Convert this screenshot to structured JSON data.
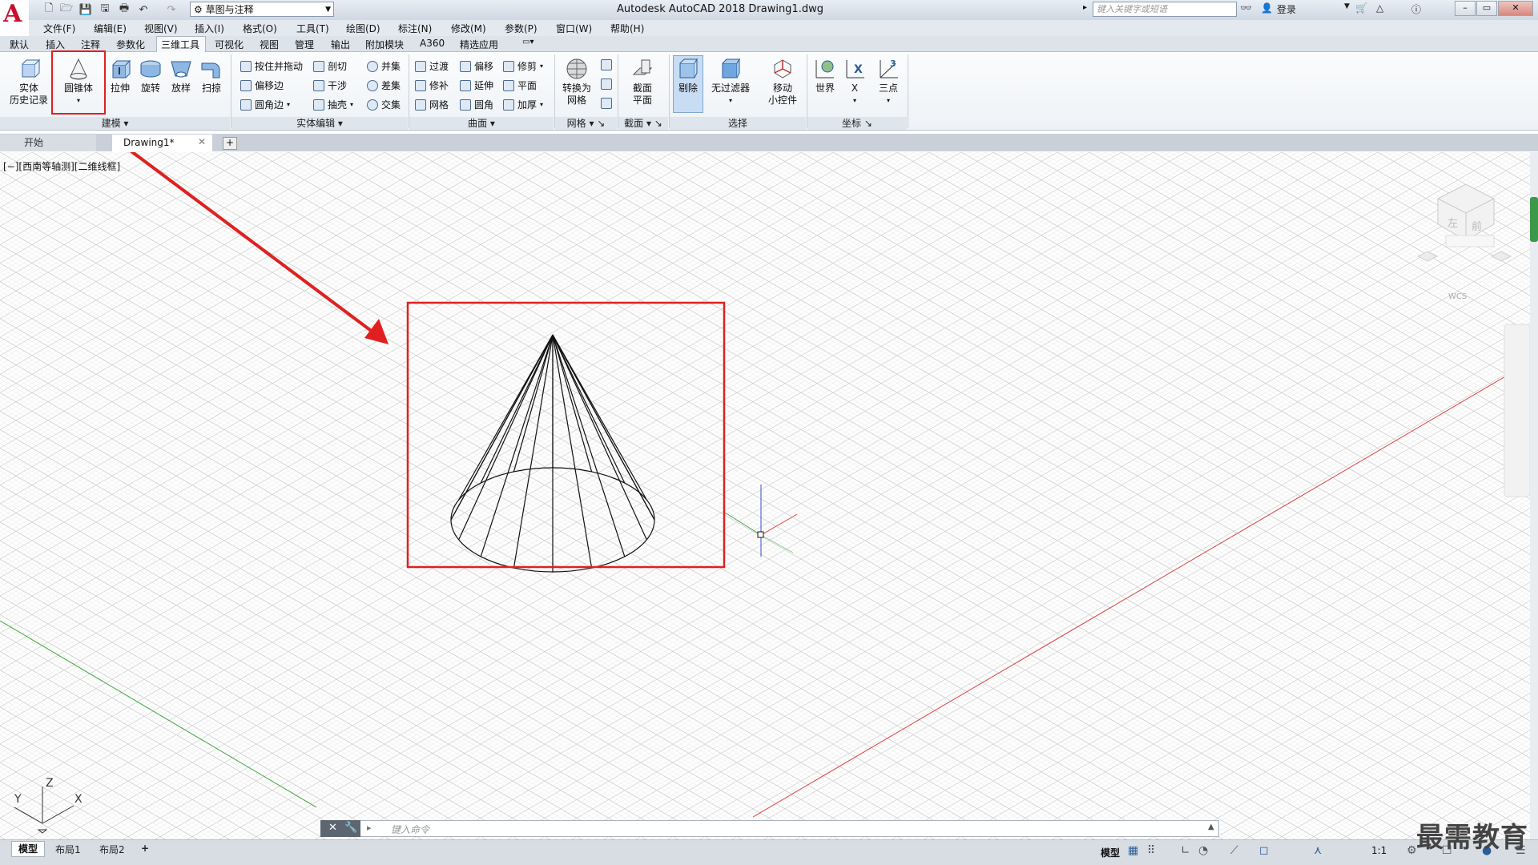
{
  "app": {
    "title": "Autodesk AutoCAD 2018    Drawing1.dwg",
    "logo": "A",
    "workspace": "草图与注释",
    "search_placeholder": "键入关键字或短语",
    "login": "登录"
  },
  "menus": [
    "文件(F)",
    "编辑(E)",
    "视图(V)",
    "插入(I)",
    "格式(O)",
    "工具(T)",
    "绘图(D)",
    "标注(N)",
    "修改(M)",
    "参数(P)",
    "窗口(W)",
    "帮助(H)"
  ],
  "ribbon_tabs": [
    "默认",
    "插入",
    "注释",
    "参数化",
    "三维工具",
    "可视化",
    "视图",
    "管理",
    "输出",
    "附加模块",
    "A360",
    "精选应用"
  ],
  "ribbon_active_tab": "三维工具",
  "ribbon": {
    "modeling": {
      "title": "建模",
      "history_label": "实体\n历史记录",
      "cone_label": "圆锥体",
      "extrude_label": "拉伸",
      "revolve_label": "旋转",
      "loft_label": "放样",
      "sweep_label": "扫掠"
    },
    "solid_edit": {
      "title": "实体编辑",
      "items": [
        "按住并拖动",
        "偏移边",
        "圆角边",
        "剖切",
        "干涉",
        "抽壳",
        "并集",
        "差集",
        "交集"
      ]
    },
    "surface": {
      "title": "曲面",
      "items": [
        "过渡",
        "修补",
        "网格",
        "偏移",
        "延伸",
        "圆角",
        "修剪",
        "平面",
        "加厚"
      ]
    },
    "mesh": {
      "title": "网格",
      "convert_label": "转换为\n网格"
    },
    "section": {
      "title": "截面",
      "plane_label": "截面\n平面"
    },
    "selection": {
      "title": "选择",
      "delete_label": "剔除",
      "nofilter_label": "无过滤器",
      "gizmo_label": "移动\n小控件"
    },
    "coords": {
      "title": "坐标",
      "world_label": "世界",
      "x_label": "X",
      "three_label": "三点"
    }
  },
  "file_tabs": {
    "start": "开始",
    "drawing": "Drawing1*"
  },
  "viewport": {
    "label": "[−][西南等轴测][二维线框]",
    "viewcube_left": "左",
    "viewcube_front": "前",
    "wcs": "WCS",
    "ucs_x": "X",
    "ucs_y": "Y",
    "ucs_z": "Z"
  },
  "command_placeholder": "键入命令",
  "layout_tabs": [
    "模型",
    "布局1",
    "布局2"
  ],
  "status": {
    "model": "模型",
    "scale": "1:1"
  },
  "watermark": "最需教育",
  "colors": {
    "highlight": "#e02020",
    "grid": "#c8c8c8",
    "x_axis": "#d84040",
    "y_axis": "#40a040",
    "z_axis": "#3050c8"
  }
}
